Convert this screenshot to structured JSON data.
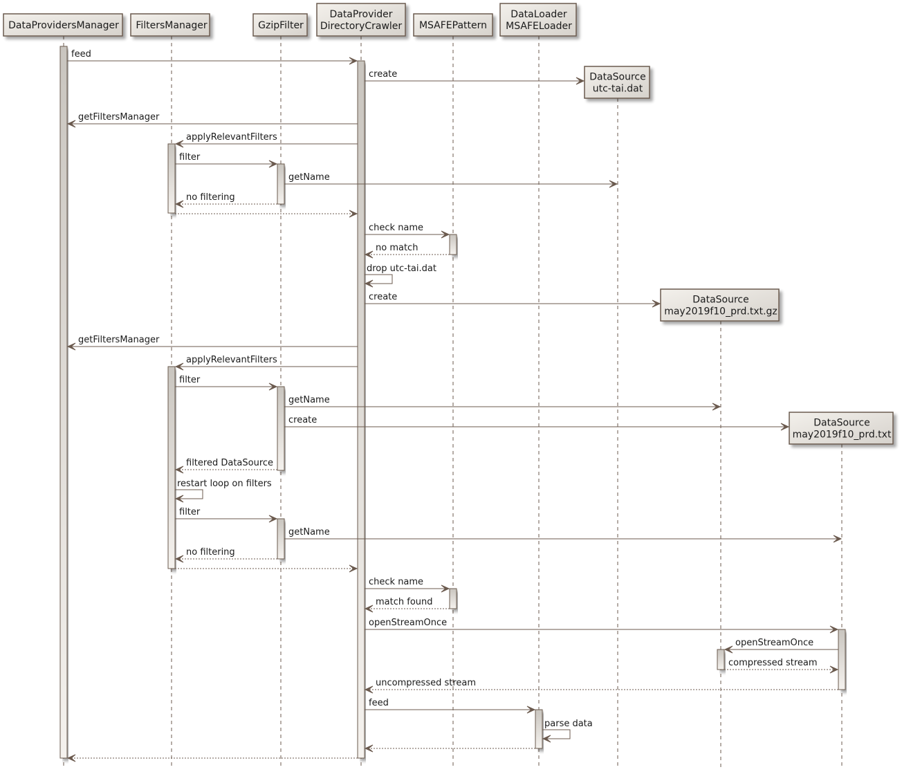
{
  "diagram": {
    "type": "sequence",
    "colors": {
      "line": "#6b5a4e",
      "box_border": "#6b5a4e",
      "box_fill_light": "#f3f0eb",
      "box_fill_dark": "#d6d2cc",
      "activation_fill_top": "#c9c5bf",
      "activation_fill_bottom": "#f5f2ee",
      "text": "#1a1a1a"
    },
    "participants": [
      {
        "id": "dpm",
        "label": [
          "DataProvidersManager"
        ]
      },
      {
        "id": "fm",
        "label": [
          "FiltersManager"
        ]
      },
      {
        "id": "gz",
        "label": [
          "GzipFilter"
        ]
      },
      {
        "id": "dc",
        "label": [
          "DataProvider",
          "DirectoryCrawler"
        ]
      },
      {
        "id": "mp",
        "label": [
          "MSAFEPattern"
        ]
      },
      {
        "id": "ml",
        "label": [
          "DataLoader",
          "MSAFELoader"
        ]
      },
      {
        "id": "ds1",
        "label": [
          "DataSource",
          "utc-tai.dat"
        ],
        "created": true
      },
      {
        "id": "ds2",
        "label": [
          "DataSource",
          "may2019f10_prd.txt.gz"
        ],
        "created": true
      },
      {
        "id": "ds3",
        "label": [
          "DataSource",
          "may2019f10_prd.txt"
        ],
        "created": true
      }
    ],
    "messages": [
      {
        "from": "dpm",
        "to": "dc",
        "label": "feed",
        "kind": "sync"
      },
      {
        "from": "dc",
        "to": "ds1",
        "label": "create",
        "kind": "create"
      },
      {
        "from": "dc",
        "to": "dpm",
        "label": "getFiltersManager",
        "kind": "sync"
      },
      {
        "from": "dc",
        "to": "fm",
        "label": "applyRelevantFilters",
        "kind": "sync"
      },
      {
        "from": "fm",
        "to": "gz",
        "label": "filter",
        "kind": "sync"
      },
      {
        "from": "gz",
        "to": "ds1",
        "label": "getName",
        "kind": "sync"
      },
      {
        "from": "gz",
        "to": "fm",
        "label": "no filtering",
        "kind": "return"
      },
      {
        "from": "fm",
        "to": "dc",
        "label": "",
        "kind": "return"
      },
      {
        "from": "dc",
        "to": "mp",
        "label": "check name",
        "kind": "sync"
      },
      {
        "from": "mp",
        "to": "dc",
        "label": "no match",
        "kind": "return"
      },
      {
        "from": "dc",
        "to": "dc",
        "label": "drop utc-tai.dat",
        "kind": "self"
      },
      {
        "from": "dc",
        "to": "ds2",
        "label": "create",
        "kind": "create"
      },
      {
        "from": "dc",
        "to": "dpm",
        "label": "getFiltersManager",
        "kind": "sync"
      },
      {
        "from": "dc",
        "to": "fm",
        "label": "applyRelevantFilters",
        "kind": "sync"
      },
      {
        "from": "fm",
        "to": "gz",
        "label": "filter",
        "kind": "sync"
      },
      {
        "from": "gz",
        "to": "ds2",
        "label": "getName",
        "kind": "sync"
      },
      {
        "from": "gz",
        "to": "ds3",
        "label": "create",
        "kind": "create"
      },
      {
        "from": "gz",
        "to": "fm",
        "label": "filtered DataSource",
        "kind": "return"
      },
      {
        "from": "fm",
        "to": "fm",
        "label": "restart loop on filters",
        "kind": "self"
      },
      {
        "from": "fm",
        "to": "gz",
        "label": "filter",
        "kind": "sync"
      },
      {
        "from": "gz",
        "to": "ds3",
        "label": "getName",
        "kind": "sync"
      },
      {
        "from": "gz",
        "to": "fm",
        "label": "no filtering",
        "kind": "return"
      },
      {
        "from": "fm",
        "to": "dc",
        "label": "",
        "kind": "return"
      },
      {
        "from": "dc",
        "to": "mp",
        "label": "check name",
        "kind": "sync"
      },
      {
        "from": "mp",
        "to": "dc",
        "label": "match found",
        "kind": "return"
      },
      {
        "from": "dc",
        "to": "ds3",
        "label": "openStreamOnce",
        "kind": "sync"
      },
      {
        "from": "ds3",
        "to": "ds2",
        "label": "openStreamOnce",
        "kind": "sync"
      },
      {
        "from": "ds2",
        "to": "ds3",
        "label": "compressed stream",
        "kind": "return"
      },
      {
        "from": "ds3",
        "to": "dc",
        "label": "uncompressed stream",
        "kind": "return"
      },
      {
        "from": "dc",
        "to": "ml",
        "label": "feed",
        "kind": "sync"
      },
      {
        "from": "ml",
        "to": "ml",
        "label": "parse data",
        "kind": "self"
      },
      {
        "from": "ml",
        "to": "dc",
        "label": "",
        "kind": "return"
      },
      {
        "from": "dc",
        "to": "dpm",
        "label": "",
        "kind": "return"
      }
    ]
  }
}
